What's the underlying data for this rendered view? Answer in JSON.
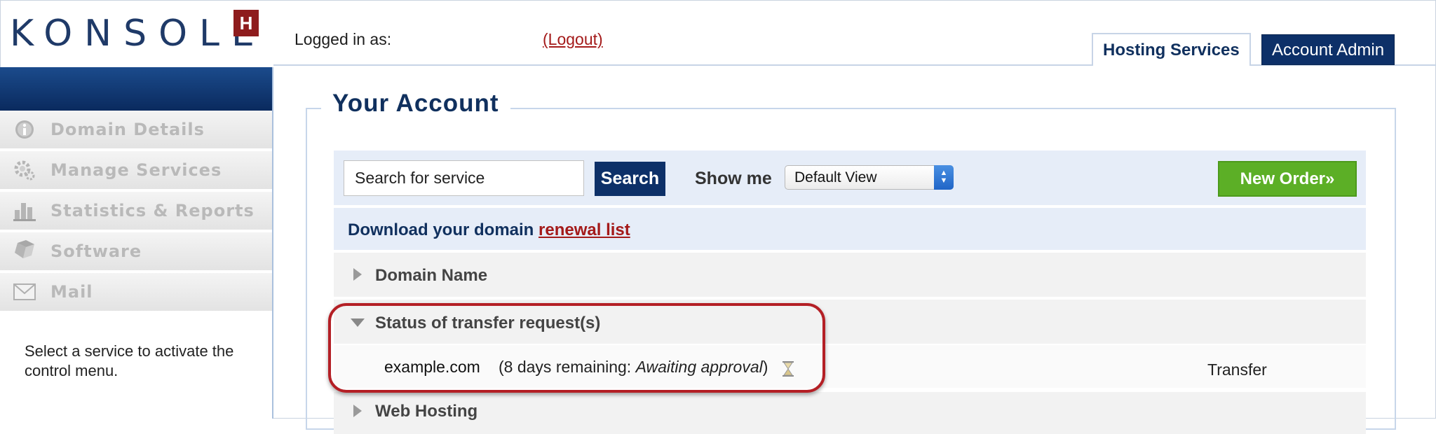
{
  "header": {
    "logo_text": "KONSOLE",
    "logo_badge": "H",
    "logged_in_label": "Logged in as:",
    "logout_label": "(Logout)",
    "tabs": [
      {
        "label": "Hosting Services",
        "active": true
      },
      {
        "label": "Account Admin",
        "active": false
      }
    ]
  },
  "sidebar": {
    "items": [
      {
        "label": "Domain Details",
        "icon": "info-icon"
      },
      {
        "label": "Manage Services",
        "icon": "gear-icon"
      },
      {
        "label": "Statistics & Reports",
        "icon": "bar-chart-icon"
      },
      {
        "label": "Software",
        "icon": "software-icon"
      },
      {
        "label": "Mail",
        "icon": "mail-icon"
      }
    ],
    "hint": "Select a service to activate the control menu."
  },
  "main": {
    "title": "Your Account",
    "search": {
      "value": "Search for service",
      "button_label": "Search"
    },
    "show_me_label": "Show me",
    "view_select": {
      "selected": "Default View"
    },
    "new_order_label": "New Order»",
    "download": {
      "text": "Download your domain ",
      "link_label": "renewal list"
    },
    "sections": [
      {
        "label": "Domain Name",
        "expanded": false
      },
      {
        "label": "Status of transfer request(s)",
        "expanded": true
      },
      {
        "label": "Web Hosting",
        "expanded": false
      }
    ],
    "transfer_item": {
      "domain": "example.com",
      "status_prefix": "(8 days remaining: ",
      "status_state": "Awaiting approval",
      "status_suffix": ")",
      "type": "Transfer"
    }
  },
  "colors": {
    "brand_navy": "#0d3068",
    "logo_badge": "#8e1c1d",
    "link_red": "#a41a1a",
    "new_order_green": "#5caf26",
    "highlight_red": "#b41f25"
  }
}
